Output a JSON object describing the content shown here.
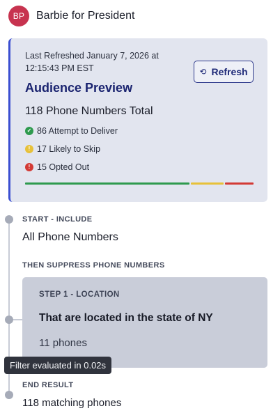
{
  "header": {
    "avatar_initials": "BP",
    "org_name": "Barbie for President"
  },
  "audience_card": {
    "last_refreshed": "Last Refreshed January 7, 2026 at 12:15:43 PM EST",
    "refresh_label": "Refresh",
    "refresh_icon": "refresh-icon",
    "title": "Audience Preview",
    "total": "118 Phone Numbers Total",
    "stats": [
      {
        "label": "86 Attempt to Deliver",
        "icon": "check-circle-icon",
        "color": "#2e9a4e",
        "value": 86
      },
      {
        "label": "17 Likely to Skip",
        "icon": "warning-circle-icon",
        "color": "#e7c13a",
        "value": 17
      },
      {
        "label": "15 Opted Out",
        "icon": "error-circle-icon",
        "color": "#d33a35",
        "value": 15
      }
    ],
    "accent_color": "#3b4fd1"
  },
  "timeline": {
    "start_label": "START - INCLUDE",
    "start_value": "All Phone Numbers",
    "suppress_label": "THEN SUPPRESS PHONE NUMBERS",
    "steps": [
      {
        "label": "STEP 1 - LOCATION",
        "description": "That are located in the state of NY",
        "count": "11 phones"
      }
    ],
    "tooltip": "Filter evaluated in 0.02s",
    "end_label": "END RESULT",
    "end_value": "118 matching phones"
  }
}
